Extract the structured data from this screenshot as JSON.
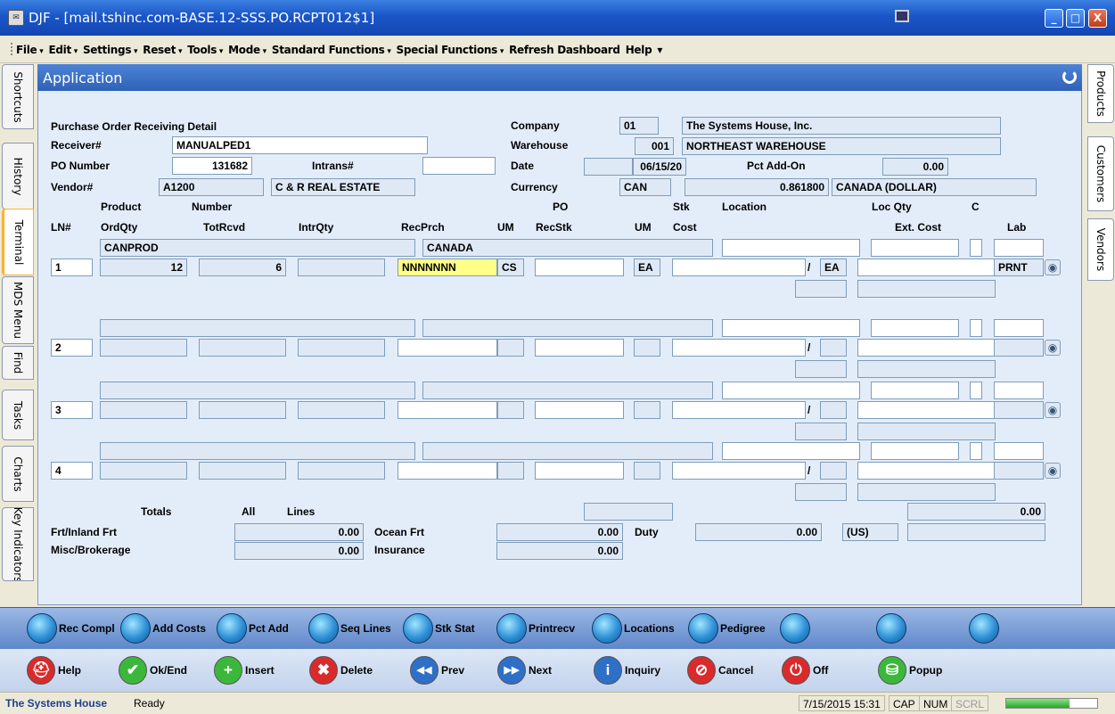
{
  "window": {
    "title": "DJF - [mail.tshinc.com-BASE.12-SSS.PO.RCPT012$1]",
    "min": "_",
    "max": "□",
    "close": "X"
  },
  "menu": [
    {
      "label": "File",
      "arrow": true
    },
    {
      "label": "Edit",
      "arrow": true
    },
    {
      "label": "Settings",
      "arrow": true
    },
    {
      "label": "Reset",
      "arrow": true
    },
    {
      "label": "Tools",
      "arrow": true
    },
    {
      "label": "Mode",
      "arrow": true
    },
    {
      "label": "Standard Functions",
      "arrow": true
    },
    {
      "label": "Special Functions",
      "arrow": true
    },
    {
      "label": "Refresh Dashboard",
      "arrow": false
    },
    {
      "label": "Help",
      "arrow": false
    },
    {
      "label": "▾",
      "arrow": false
    }
  ],
  "left_tabs": [
    "Shortcuts",
    "History",
    "Terminal",
    "MDS Menu",
    "Find",
    "Tasks",
    "Charts",
    "Key Indicators"
  ],
  "right_tabs": [
    "Products",
    "Customers",
    "Vendors"
  ],
  "app_title": "Application",
  "form": {
    "heading": "Purchase Order Receiving Detail",
    "receiver_label": "Receiver#",
    "receiver": "MANUALPED1",
    "po_label": "PO Number",
    "po": "131682",
    "intrans_label": "Intrans#",
    "intrans": "",
    "vendor_label": "Vendor#",
    "vendor": "A1200",
    "vendor_name": "C & R REAL ESTATE",
    "company_label": "Company",
    "company": "01",
    "company_name": "The Systems House, Inc.",
    "warehouse_label": "Warehouse",
    "warehouse": "001",
    "warehouse_name": "NORTHEAST WAREHOUSE",
    "date_label": "Date",
    "date_blank": "",
    "date": "06/15/20",
    "pctaddon_label": "Pct Add-On",
    "pctaddon": "0.00",
    "currency_label": "Currency",
    "currency": "CAN",
    "rate": "0.861800",
    "currency_name": "CANADA (DOLLAR)"
  },
  "grid_headers": {
    "product": "Product",
    "number": "Number",
    "po": "PO",
    "stk": "Stk",
    "location": "Location",
    "locqty": "Loc Qty",
    "c": "C",
    "ln": "LN#",
    "ordqty": "OrdQty",
    "totrcvd": "TotRcvd",
    "intrqty": "IntrQty",
    "recprch": "RecPrch",
    "um": "UM",
    "recstk": "RecStk",
    "um2": "UM",
    "cost": "Cost",
    "extcost": "Ext. Cost",
    "lab": "Lab"
  },
  "lines": [
    {
      "ln": "1",
      "product": "CANPROD",
      "desc": "CANADA",
      "ordqty": "12",
      "totrcvd": "6",
      "intrqty": "",
      "recprch": "NNNNNNN",
      "um": "CS",
      "recstk": "",
      "um2": "EA",
      "cost": "",
      "slash": "/",
      "cost_um": "EA",
      "location": "",
      "lab": "PRNT"
    },
    {
      "ln": "2",
      "product": "",
      "desc": "",
      "ordqty": "",
      "totrcvd": "",
      "intrqty": "",
      "recprch": "",
      "um": "",
      "recstk": "",
      "um2": "",
      "cost": "",
      "slash": "/",
      "cost_um": "",
      "location": "",
      "lab": ""
    },
    {
      "ln": "3",
      "product": "",
      "desc": "",
      "ordqty": "",
      "totrcvd": "",
      "intrqty": "",
      "recprch": "",
      "um": "",
      "recstk": "",
      "um2": "",
      "cost": "",
      "slash": "/",
      "cost_um": "",
      "location": "",
      "lab": ""
    },
    {
      "ln": "4",
      "product": "",
      "desc": "",
      "ordqty": "",
      "totrcvd": "",
      "intrqty": "",
      "recprch": "",
      "um": "",
      "recstk": "",
      "um2": "",
      "cost": "",
      "slash": "/",
      "cost_um": "",
      "location": "",
      "lab": ""
    }
  ],
  "totals": {
    "totals_label": "Totals",
    "all_label": "All",
    "lines_label": "Lines",
    "total_value": "0.00",
    "frt_label": "Frt/Inland Frt",
    "frt": "0.00",
    "ocean_label": "Ocean Frt",
    "ocean": "0.00",
    "duty_label": "Duty",
    "duty": "0.00",
    "duty_currency": "(US)",
    "misc_label": "Misc/Brokerage",
    "misc": "0.00",
    "insurance_label": "Insurance",
    "insurance": "0.00"
  },
  "function_buttons": [
    "Rec Compl",
    "Add Costs",
    "Pct Add",
    "Seq Lines",
    "Stk Stat",
    "Printrecv",
    "Locations",
    "Pedigree",
    "",
    "",
    ""
  ],
  "action_buttons": [
    {
      "label": "Help",
      "icon": "help-icon",
      "color": "#d92b2b"
    },
    {
      "label": "Ok/End",
      "icon": "check-icon",
      "color": "#3bb83b"
    },
    {
      "label": "Insert",
      "icon": "plus-icon",
      "color": "#3bb83b"
    },
    {
      "label": "Delete",
      "icon": "x-icon",
      "color": "#d92b2b"
    },
    {
      "label": "Prev",
      "icon": "rewind-icon",
      "color": "#2e6fc8"
    },
    {
      "label": "Next",
      "icon": "fastforward-icon",
      "color": "#2e6fc8"
    },
    {
      "label": "Inquiry",
      "icon": "info-icon",
      "color": "#2e6fc8"
    },
    {
      "label": "Cancel",
      "icon": "cancel-icon",
      "color": "#d92b2b"
    },
    {
      "label": "Off",
      "icon": "power-icon",
      "color": "#d92b2b"
    },
    {
      "label": "Popup",
      "icon": "database-plus-icon",
      "color": "#3bb83b"
    }
  ],
  "status": {
    "brand": "The Systems House",
    "ready": "Ready",
    "datetime": "7/15/2015 15:31",
    "cap": "CAP",
    "num": "NUM",
    "scrl": "SCRL",
    "progress": 0.7
  }
}
